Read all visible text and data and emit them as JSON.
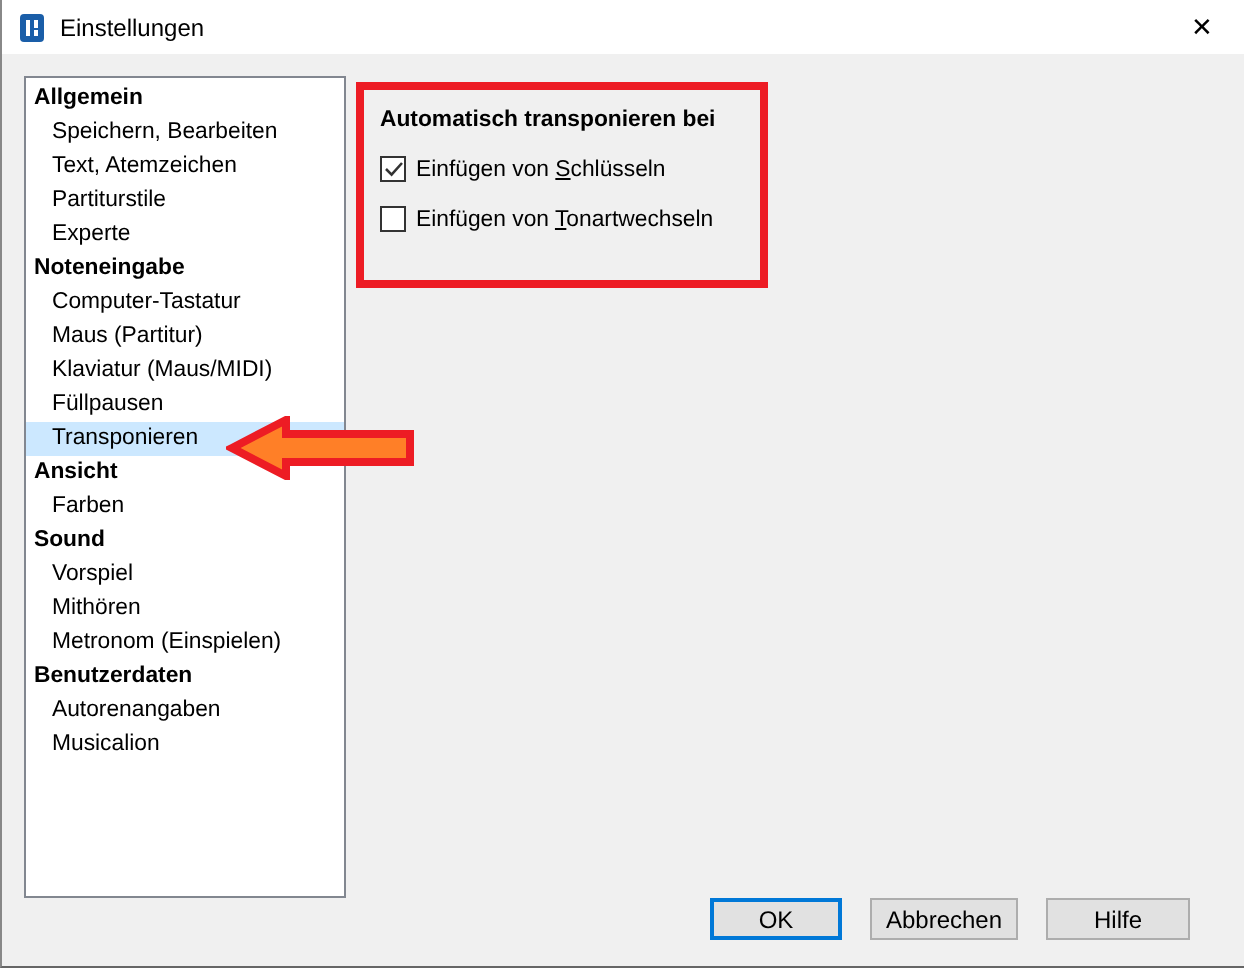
{
  "window": {
    "title": "Einstellungen",
    "close": "✕"
  },
  "sidebar": {
    "groups": [
      {
        "label": "Allgemein",
        "children": [
          {
            "label": "Speichern, Bearbeiten",
            "selected": false
          },
          {
            "label": "Text, Atemzeichen",
            "selected": false
          },
          {
            "label": "Partiturstile",
            "selected": false
          },
          {
            "label": "Experte",
            "selected": false
          }
        ]
      },
      {
        "label": "Noteneingabe",
        "children": [
          {
            "label": "Computer-Tastatur",
            "selected": false
          },
          {
            "label": "Maus (Partitur)",
            "selected": false
          },
          {
            "label": "Klaviatur (Maus/MIDI)",
            "selected": false
          },
          {
            "label": "Füllpausen",
            "selected": false
          },
          {
            "label": "Transponieren",
            "selected": true
          }
        ]
      },
      {
        "label": "Ansicht",
        "children": [
          {
            "label": "Farben",
            "selected": false
          }
        ]
      },
      {
        "label": "Sound",
        "children": [
          {
            "label": "Vorspiel",
            "selected": false
          },
          {
            "label": "Mithören",
            "selected": false
          },
          {
            "label": "Metronom (Einspielen)",
            "selected": false
          }
        ]
      },
      {
        "label": "Benutzerdaten",
        "children": [
          {
            "label": "Autorenangaben",
            "selected": false
          },
          {
            "label": "Musicalion",
            "selected": false
          }
        ]
      }
    ]
  },
  "panel": {
    "title": "Automatisch transponieren bei",
    "options": [
      {
        "label_before": "Einfügen von ",
        "access_key": "S",
        "label_after": "chlüsseln",
        "checked": true
      },
      {
        "label_before": "Einfügen von ",
        "access_key": "T",
        "label_after": "onartwechseln",
        "checked": false
      }
    ]
  },
  "buttons": [
    {
      "label": "OK",
      "default": true
    },
    {
      "label": "Abbrechen",
      "default": false
    },
    {
      "label": "Hilfe",
      "default": false
    }
  ]
}
